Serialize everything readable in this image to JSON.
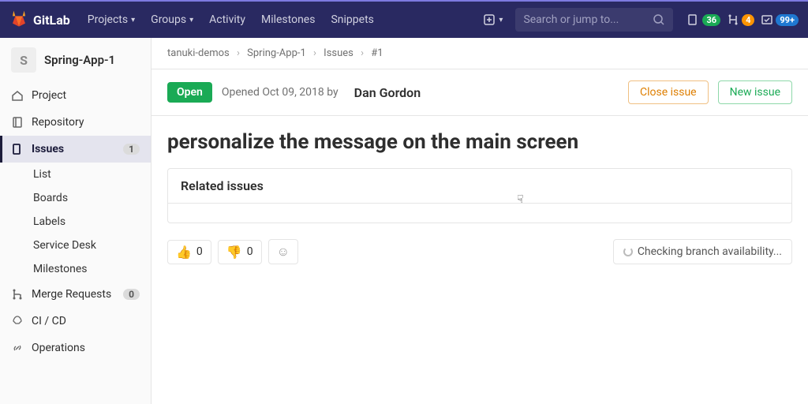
{
  "brand": "GitLab",
  "topnav": {
    "items": [
      "Projects",
      "Groups",
      "Activity",
      "Milestones",
      "Snippets"
    ],
    "has_caret": [
      true,
      true,
      false,
      false,
      false
    ]
  },
  "search": {
    "placeholder": "Search or jump to..."
  },
  "counters": {
    "issues": "36",
    "mrs": "4",
    "todos": "99+"
  },
  "project": {
    "initial": "S",
    "name": "Spring-App-1"
  },
  "sidebar": {
    "items": [
      {
        "label": "Project",
        "icon": "home"
      },
      {
        "label": "Repository",
        "icon": "repo"
      },
      {
        "label": "Issues",
        "icon": "issues",
        "active": true,
        "count": "1"
      },
      {
        "label": "Merge Requests",
        "icon": "mr",
        "count": "0"
      },
      {
        "label": "CI / CD",
        "icon": "cicd"
      },
      {
        "label": "Operations",
        "icon": "ops"
      }
    ],
    "issue_subs": [
      "List",
      "Boards",
      "Labels",
      "Service Desk",
      "Milestones"
    ]
  },
  "breadcrumb": {
    "parts": [
      "tanuki-demos",
      "Spring-App-1",
      "Issues",
      "#1"
    ]
  },
  "issue": {
    "status": "Open",
    "opened": "Opened Oct 09, 2018 by",
    "author": "Dan Gordon",
    "title": "personalize the message on the main screen",
    "close_btn": "Close issue",
    "new_btn": "New issue"
  },
  "related_panel": {
    "title": "Related issues"
  },
  "reactions": {
    "up": "0",
    "down": "0"
  },
  "branch_check": "Checking branch availability..."
}
